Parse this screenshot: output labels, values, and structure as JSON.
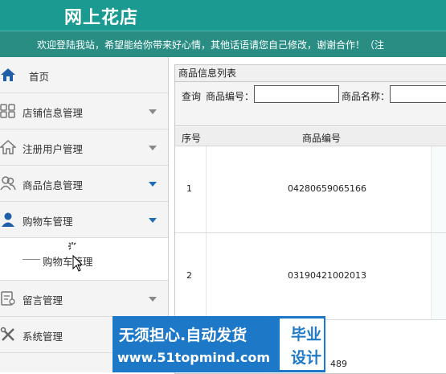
{
  "header": {
    "site_title": "网上花店",
    "notice": "欢迎登陆我站，希望能给你带来好心情，其他话语请您自己修改，谢谢合作！（注"
  },
  "sidebar": {
    "items": [
      {
        "label": "首页",
        "icon": "home-icon",
        "expanded": null
      },
      {
        "label": "店铺信息管理",
        "icon": "grid-icon",
        "expanded": false
      },
      {
        "label": "注册用户管理",
        "icon": "house-icon",
        "expanded": false
      },
      {
        "label": "商品信息管理",
        "icon": "users-icon",
        "expanded": false
      },
      {
        "label": "购物车管理",
        "icon": "user-icon",
        "expanded": true
      },
      {
        "label": "留言管理",
        "icon": "message-icon",
        "expanded": false
      },
      {
        "label": "系统管理",
        "icon": "tools-icon",
        "expanded": false
      }
    ],
    "sub_items": [
      {
        "label": "购物车管理"
      }
    ]
  },
  "panel": {
    "title": "商品信息列表",
    "search_label": "查询",
    "field1_label": "商品编号：",
    "field2_label": "商品名称：",
    "field1_value": "",
    "field2_value": ""
  },
  "table": {
    "headers": [
      "序号",
      "商品编号"
    ],
    "rows": [
      {
        "index": "1",
        "code": "04280659065166"
      },
      {
        "index": "2",
        "code": "03190421002013"
      }
    ],
    "partial_row_code": "489"
  },
  "watermark": {
    "line1": "无须担心.自动发货",
    "line2": "www.51topmind.com",
    "box1": "毕业",
    "box2": "设计"
  },
  "colors": {
    "header_bg": "#1b9a92",
    "notice_bg": "#2a8d84",
    "accent_blue": "#1e6fb8",
    "watermark_bg": "#1e78c8"
  }
}
